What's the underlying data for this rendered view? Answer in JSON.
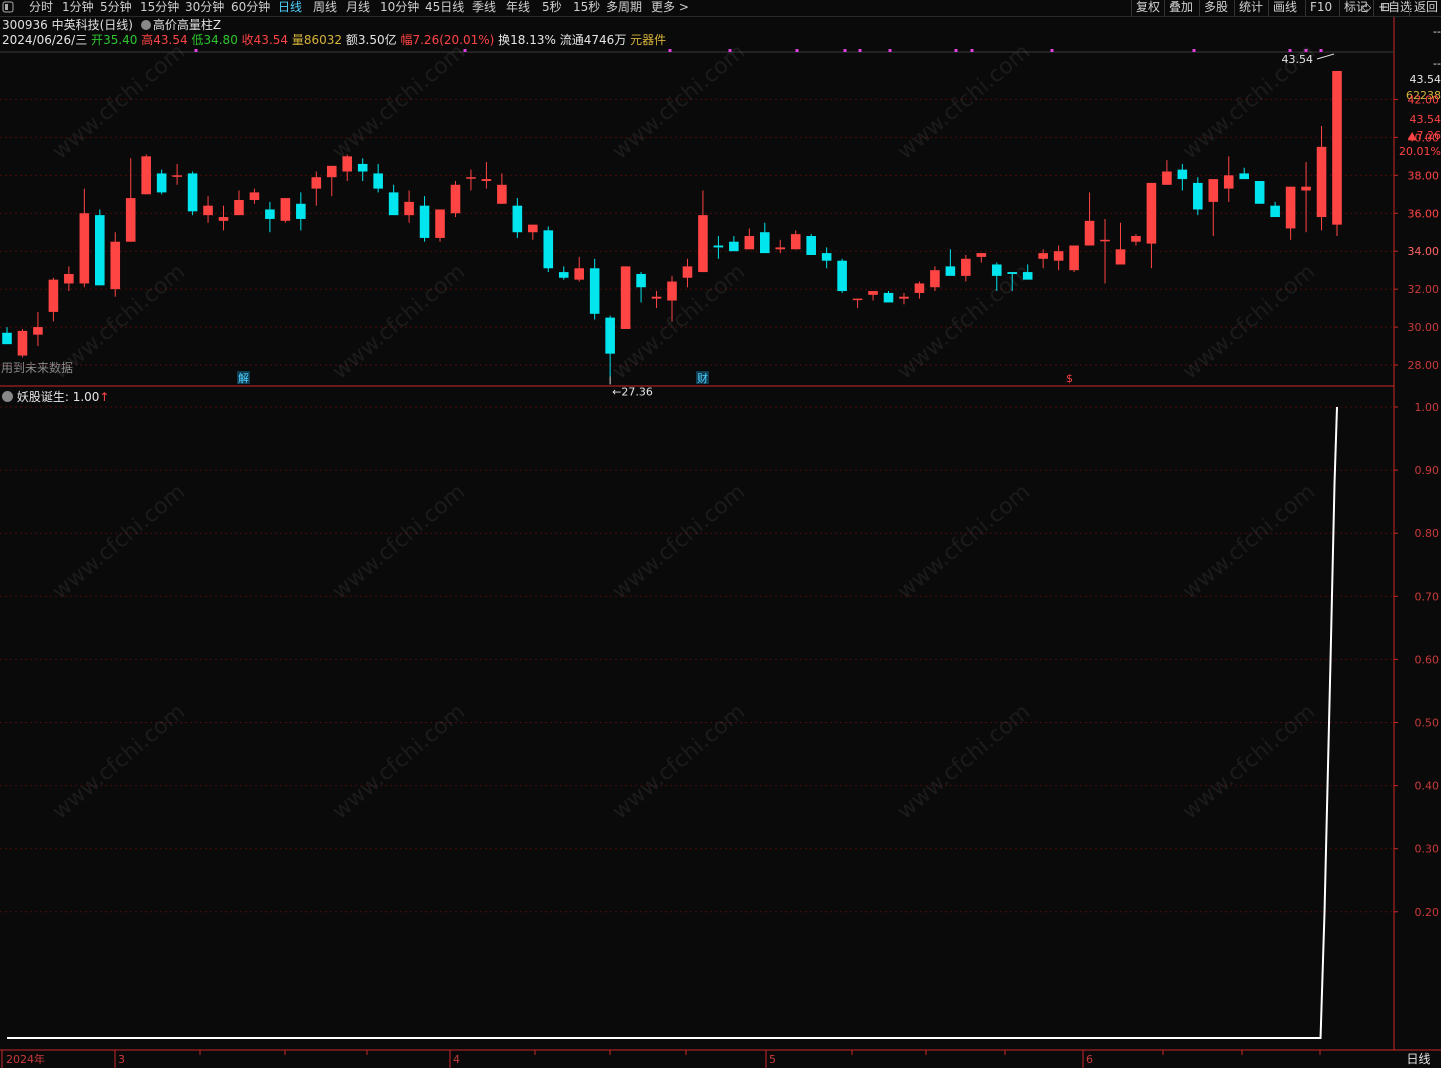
{
  "toolbar": {
    "tabs": [
      "分时",
      "1分钟",
      "5分钟",
      "15分钟",
      "30分钟",
      "60分钟",
      "日线",
      "周线",
      "月线",
      "10分钟",
      "45日线",
      "季线",
      "年线",
      "5秒",
      "15秒",
      "多周期",
      "更多 >"
    ],
    "active_tab": "日线",
    "right_tabs": [
      "复权",
      "叠加",
      "多股",
      "统计",
      "画线",
      "F10",
      "标记",
      "+自选",
      "返回"
    ]
  },
  "stock": {
    "code_name": "300936 中英科技(日线)",
    "indicator": "高价高量柱Z"
  },
  "info": {
    "date": "2024/06/26/三",
    "open_label": "开",
    "open": "35.40",
    "high_label": "高",
    "high": "43.54",
    "low_label": "低",
    "low": "34.80",
    "close_label": "收",
    "close": "43.54",
    "vol_label": "量",
    "vol": "86032",
    "amount_label": "额",
    "amount": "3.50亿",
    "range_label": "幅",
    "range": "7.26(20.01%)",
    "turnover_label": "换",
    "turnover": "18.13%",
    "float_label": "流通",
    "float": "4746万",
    "component": "元器件"
  },
  "price_panel": {
    "max_label": "43.54",
    "min_label": "27.36",
    "future_note": "用到未来数据",
    "event_marks": [
      "解",
      "财",
      "$"
    ]
  },
  "right_info": {
    "dash1": "--",
    "dash2": "--",
    "price": "43.54",
    "vol": "62238",
    "close": "43.54",
    "change": "▲7.26",
    "pct": "20.01%",
    "period": "日线"
  },
  "colors": {
    "up": "#ff4444",
    "down": "#00e5ee",
    "grid": "#4a0d0d",
    "axis_red": "#c8282a",
    "white_line": "#ffffff"
  },
  "indicator_panel": {
    "name": "妖股诞生",
    "value_text": ": 1.00",
    "arrow": "↑"
  },
  "x_axis": {
    "labels": [
      "2024年",
      "3",
      "4",
      "5",
      "6"
    ]
  },
  "chart_data": [
    {
      "type": "candlestick",
      "title": "300936 中英科技(日线)",
      "ylim": [
        27,
        44.5
      ],
      "y_ticks": [
        28,
        30,
        32,
        34,
        36,
        38,
        40,
        42
      ],
      "ohlc": [
        [
          29.7,
          30.0,
          29.1,
          29.1
        ],
        [
          28.5,
          29.9,
          28.4,
          29.8
        ],
        [
          29.6,
          30.8,
          29.0,
          30.0
        ],
        [
          30.8,
          32.6,
          30.3,
          32.5
        ],
        [
          32.3,
          33.2,
          31.9,
          32.8
        ],
        [
          32.3,
          37.3,
          32.1,
          36.0
        ],
        [
          35.9,
          36.2,
          32.6,
          32.2
        ],
        [
          32.0,
          35.0,
          31.6,
          34.5
        ],
        [
          34.5,
          38.9,
          34.5,
          36.8
        ],
        [
          37.0,
          39.1,
          37.0,
          39.0
        ],
        [
          38.1,
          38.3,
          37.0,
          37.1
        ],
        [
          38.0,
          38.6,
          37.5,
          38.0
        ],
        [
          38.1,
          38.2,
          35.9,
          36.1
        ],
        [
          35.9,
          36.9,
          35.5,
          36.4
        ],
        [
          35.6,
          36.4,
          35.1,
          35.8
        ],
        [
          35.9,
          37.2,
          35.9,
          36.7
        ],
        [
          36.7,
          37.3,
          36.5,
          37.1
        ],
        [
          36.2,
          36.6,
          35.0,
          35.7
        ],
        [
          35.6,
          36.7,
          35.5,
          36.8
        ],
        [
          36.5,
          37.1,
          35.1,
          35.7
        ],
        [
          37.3,
          38.2,
          36.4,
          37.9
        ],
        [
          37.9,
          38.2,
          36.9,
          38.5
        ],
        [
          38.2,
          39.1,
          37.7,
          39.0
        ],
        [
          38.6,
          38.9,
          37.7,
          38.2
        ],
        [
          38.1,
          38.6,
          37.1,
          37.3
        ],
        [
          37.1,
          37.5,
          36.2,
          35.9
        ],
        [
          35.9,
          37.2,
          35.5,
          36.6
        ],
        [
          36.4,
          36.9,
          34.5,
          34.7
        ],
        [
          34.7,
          35.7,
          34.5,
          36.2
        ],
        [
          36.0,
          37.7,
          35.8,
          37.5
        ],
        [
          37.9,
          38.3,
          37.2,
          37.9
        ],
        [
          37.7,
          38.7,
          37.3,
          37.8
        ],
        [
          36.5,
          38.1,
          36.5,
          37.5
        ],
        [
          36.4,
          36.8,
          34.7,
          35.0
        ],
        [
          35.0,
          35.4,
          34.6,
          35.4
        ],
        [
          35.1,
          35.3,
          32.9,
          33.1
        ],
        [
          32.9,
          33.2,
          32.5,
          32.6
        ],
        [
          32.5,
          33.7,
          32.4,
          33.1
        ],
        [
          33.1,
          33.6,
          30.4,
          30.7
        ],
        [
          30.5,
          30.6,
          27.4,
          28.6
        ],
        [
          29.9,
          33.2,
          29.9,
          33.2
        ],
        [
          32.8,
          32.9,
          31.3,
          32.1
        ],
        [
          31.5,
          31.9,
          31.0,
          31.6
        ],
        [
          31.4,
          32.7,
          30.3,
          32.4
        ],
        [
          32.6,
          33.6,
          32.1,
          33.2
        ],
        [
          32.9,
          37.2,
          32.9,
          35.9
        ],
        [
          34.3,
          34.8,
          33.6,
          34.2
        ],
        [
          34.5,
          34.8,
          34.1,
          34.0
        ],
        [
          34.1,
          35.2,
          34.1,
          34.8
        ],
        [
          35.0,
          35.5,
          33.9,
          33.9
        ],
        [
          34.1,
          34.6,
          33.9,
          34.2
        ],
        [
          34.1,
          35.1,
          34.1,
          34.9
        ],
        [
          34.8,
          34.9,
          33.8,
          33.8
        ],
        [
          33.9,
          34.2,
          33.1,
          33.5
        ],
        [
          33.5,
          33.6,
          31.8,
          31.9
        ],
        [
          31.5,
          31.5,
          31.0,
          31.5
        ],
        [
          31.7,
          31.9,
          31.4,
          31.9
        ],
        [
          31.8,
          31.9,
          31.3,
          31.3
        ],
        [
          31.5,
          31.8,
          31.2,
          31.6
        ],
        [
          31.8,
          32.4,
          31.5,
          32.3
        ],
        [
          32.1,
          33.2,
          31.9,
          33.0
        ],
        [
          33.2,
          34.1,
          32.9,
          32.7
        ],
        [
          32.7,
          33.8,
          32.4,
          33.6
        ],
        [
          33.7,
          33.9,
          33.4,
          33.9
        ],
        [
          33.3,
          33.4,
          31.9,
          32.7
        ],
        [
          32.9,
          32.9,
          31.9,
          32.8
        ],
        [
          32.9,
          33.3,
          32.5,
          32.5
        ],
        [
          33.6,
          34.1,
          33.1,
          33.9
        ],
        [
          33.5,
          34.3,
          33.0,
          34.0
        ],
        [
          33.0,
          34.1,
          32.9,
          34.3
        ],
        [
          34.3,
          37.1,
          34.3,
          35.6
        ],
        [
          34.6,
          35.7,
          32.3,
          34.6
        ],
        [
          33.3,
          35.5,
          33.3,
          34.1
        ],
        [
          34.5,
          34.9,
          34.3,
          34.8
        ],
        [
          34.4,
          37.6,
          33.1,
          37.6
        ],
        [
          37.5,
          38.8,
          37.5,
          38.2
        ],
        [
          38.3,
          38.6,
          37.2,
          37.8
        ],
        [
          37.6,
          37.9,
          35.9,
          36.2
        ],
        [
          36.6,
          37.7,
          34.8,
          37.8
        ],
        [
          37.3,
          39.0,
          36.6,
          38.0
        ],
        [
          38.1,
          38.4,
          37.9,
          37.8
        ],
        [
          37.7,
          37.6,
          36.5,
          36.5
        ],
        [
          36.4,
          36.6,
          36.0,
          35.8
        ],
        [
          35.2,
          37.4,
          34.6,
          37.4
        ],
        [
          37.2,
          38.7,
          35.0,
          37.4
        ],
        [
          35.8,
          40.6,
          35.1,
          39.5
        ],
        [
          35.4,
          43.5,
          34.8,
          43.5
        ]
      ],
      "ohlc_note": "open,high,low,close per trading day, Jan 2024 to 2024/06/26"
    },
    {
      "type": "line",
      "title": "妖股诞生",
      "ylim": [
        0,
        1.0
      ],
      "y_ticks": [
        0.2,
        0.3,
        0.4,
        0.5,
        0.6,
        0.7,
        0.8,
        0.9,
        1.0
      ],
      "series": [
        {
          "name": "妖股诞生",
          "values_note": "0 for all days, rising to 1.00 on the last day",
          "last_value": 1.0
        }
      ]
    }
  ]
}
